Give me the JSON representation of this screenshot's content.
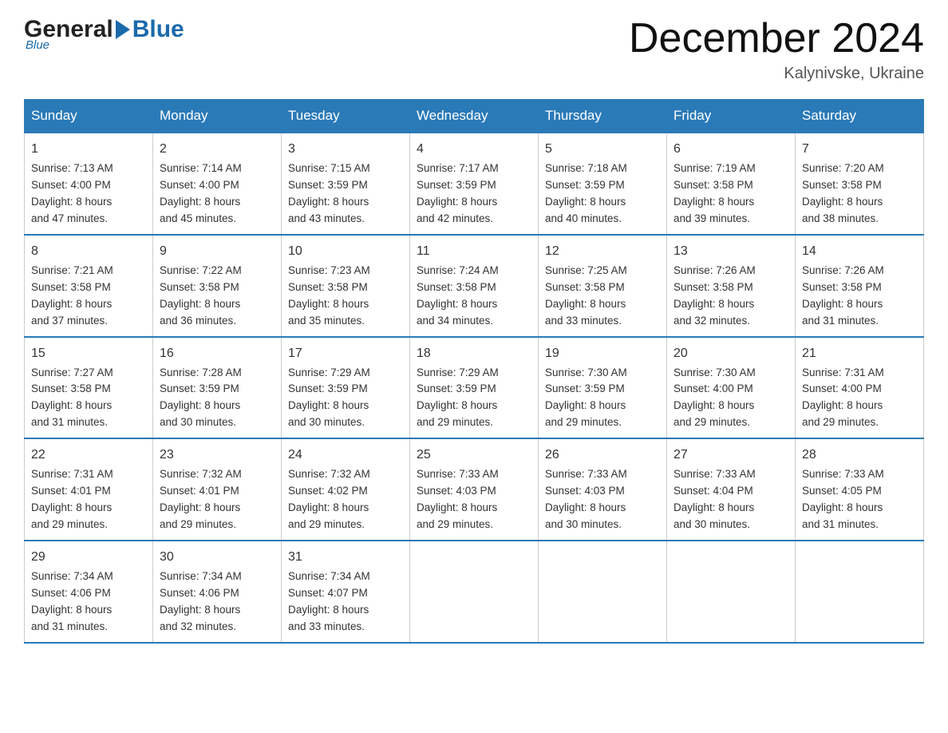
{
  "header": {
    "logo": {
      "general": "General",
      "blue": "Blue",
      "sub": "Blue"
    },
    "title": "December 2024",
    "location": "Kalynivske, Ukraine"
  },
  "days_of_week": [
    "Sunday",
    "Monday",
    "Tuesday",
    "Wednesday",
    "Thursday",
    "Friday",
    "Saturday"
  ],
  "weeks": [
    [
      {
        "day": "1",
        "sunrise": "Sunrise: 7:13 AM",
        "sunset": "Sunset: 4:00 PM",
        "daylight": "Daylight: 8 hours",
        "daylight2": "and 47 minutes."
      },
      {
        "day": "2",
        "sunrise": "Sunrise: 7:14 AM",
        "sunset": "Sunset: 4:00 PM",
        "daylight": "Daylight: 8 hours",
        "daylight2": "and 45 minutes."
      },
      {
        "day": "3",
        "sunrise": "Sunrise: 7:15 AM",
        "sunset": "Sunset: 3:59 PM",
        "daylight": "Daylight: 8 hours",
        "daylight2": "and 43 minutes."
      },
      {
        "day": "4",
        "sunrise": "Sunrise: 7:17 AM",
        "sunset": "Sunset: 3:59 PM",
        "daylight": "Daylight: 8 hours",
        "daylight2": "and 42 minutes."
      },
      {
        "day": "5",
        "sunrise": "Sunrise: 7:18 AM",
        "sunset": "Sunset: 3:59 PM",
        "daylight": "Daylight: 8 hours",
        "daylight2": "and 40 minutes."
      },
      {
        "day": "6",
        "sunrise": "Sunrise: 7:19 AM",
        "sunset": "Sunset: 3:58 PM",
        "daylight": "Daylight: 8 hours",
        "daylight2": "and 39 minutes."
      },
      {
        "day": "7",
        "sunrise": "Sunrise: 7:20 AM",
        "sunset": "Sunset: 3:58 PM",
        "daylight": "Daylight: 8 hours",
        "daylight2": "and 38 minutes."
      }
    ],
    [
      {
        "day": "8",
        "sunrise": "Sunrise: 7:21 AM",
        "sunset": "Sunset: 3:58 PM",
        "daylight": "Daylight: 8 hours",
        "daylight2": "and 37 minutes."
      },
      {
        "day": "9",
        "sunrise": "Sunrise: 7:22 AM",
        "sunset": "Sunset: 3:58 PM",
        "daylight": "Daylight: 8 hours",
        "daylight2": "and 36 minutes."
      },
      {
        "day": "10",
        "sunrise": "Sunrise: 7:23 AM",
        "sunset": "Sunset: 3:58 PM",
        "daylight": "Daylight: 8 hours",
        "daylight2": "and 35 minutes."
      },
      {
        "day": "11",
        "sunrise": "Sunrise: 7:24 AM",
        "sunset": "Sunset: 3:58 PM",
        "daylight": "Daylight: 8 hours",
        "daylight2": "and 34 minutes."
      },
      {
        "day": "12",
        "sunrise": "Sunrise: 7:25 AM",
        "sunset": "Sunset: 3:58 PM",
        "daylight": "Daylight: 8 hours",
        "daylight2": "and 33 minutes."
      },
      {
        "day": "13",
        "sunrise": "Sunrise: 7:26 AM",
        "sunset": "Sunset: 3:58 PM",
        "daylight": "Daylight: 8 hours",
        "daylight2": "and 32 minutes."
      },
      {
        "day": "14",
        "sunrise": "Sunrise: 7:26 AM",
        "sunset": "Sunset: 3:58 PM",
        "daylight": "Daylight: 8 hours",
        "daylight2": "and 31 minutes."
      }
    ],
    [
      {
        "day": "15",
        "sunrise": "Sunrise: 7:27 AM",
        "sunset": "Sunset: 3:58 PM",
        "daylight": "Daylight: 8 hours",
        "daylight2": "and 31 minutes."
      },
      {
        "day": "16",
        "sunrise": "Sunrise: 7:28 AM",
        "sunset": "Sunset: 3:59 PM",
        "daylight": "Daylight: 8 hours",
        "daylight2": "and 30 minutes."
      },
      {
        "day": "17",
        "sunrise": "Sunrise: 7:29 AM",
        "sunset": "Sunset: 3:59 PM",
        "daylight": "Daylight: 8 hours",
        "daylight2": "and 30 minutes."
      },
      {
        "day": "18",
        "sunrise": "Sunrise: 7:29 AM",
        "sunset": "Sunset: 3:59 PM",
        "daylight": "Daylight: 8 hours",
        "daylight2": "and 29 minutes."
      },
      {
        "day": "19",
        "sunrise": "Sunrise: 7:30 AM",
        "sunset": "Sunset: 3:59 PM",
        "daylight": "Daylight: 8 hours",
        "daylight2": "and 29 minutes."
      },
      {
        "day": "20",
        "sunrise": "Sunrise: 7:30 AM",
        "sunset": "Sunset: 4:00 PM",
        "daylight": "Daylight: 8 hours",
        "daylight2": "and 29 minutes."
      },
      {
        "day": "21",
        "sunrise": "Sunrise: 7:31 AM",
        "sunset": "Sunset: 4:00 PM",
        "daylight": "Daylight: 8 hours",
        "daylight2": "and 29 minutes."
      }
    ],
    [
      {
        "day": "22",
        "sunrise": "Sunrise: 7:31 AM",
        "sunset": "Sunset: 4:01 PM",
        "daylight": "Daylight: 8 hours",
        "daylight2": "and 29 minutes."
      },
      {
        "day": "23",
        "sunrise": "Sunrise: 7:32 AM",
        "sunset": "Sunset: 4:01 PM",
        "daylight": "Daylight: 8 hours",
        "daylight2": "and 29 minutes."
      },
      {
        "day": "24",
        "sunrise": "Sunrise: 7:32 AM",
        "sunset": "Sunset: 4:02 PM",
        "daylight": "Daylight: 8 hours",
        "daylight2": "and 29 minutes."
      },
      {
        "day": "25",
        "sunrise": "Sunrise: 7:33 AM",
        "sunset": "Sunset: 4:03 PM",
        "daylight": "Daylight: 8 hours",
        "daylight2": "and 29 minutes."
      },
      {
        "day": "26",
        "sunrise": "Sunrise: 7:33 AM",
        "sunset": "Sunset: 4:03 PM",
        "daylight": "Daylight: 8 hours",
        "daylight2": "and 30 minutes."
      },
      {
        "day": "27",
        "sunrise": "Sunrise: 7:33 AM",
        "sunset": "Sunset: 4:04 PM",
        "daylight": "Daylight: 8 hours",
        "daylight2": "and 30 minutes."
      },
      {
        "day": "28",
        "sunrise": "Sunrise: 7:33 AM",
        "sunset": "Sunset: 4:05 PM",
        "daylight": "Daylight: 8 hours",
        "daylight2": "and 31 minutes."
      }
    ],
    [
      {
        "day": "29",
        "sunrise": "Sunrise: 7:34 AM",
        "sunset": "Sunset: 4:06 PM",
        "daylight": "Daylight: 8 hours",
        "daylight2": "and 31 minutes."
      },
      {
        "day": "30",
        "sunrise": "Sunrise: 7:34 AM",
        "sunset": "Sunset: 4:06 PM",
        "daylight": "Daylight: 8 hours",
        "daylight2": "and 32 minutes."
      },
      {
        "day": "31",
        "sunrise": "Sunrise: 7:34 AM",
        "sunset": "Sunset: 4:07 PM",
        "daylight": "Daylight: 8 hours",
        "daylight2": "and 33 minutes."
      },
      null,
      null,
      null,
      null
    ]
  ]
}
